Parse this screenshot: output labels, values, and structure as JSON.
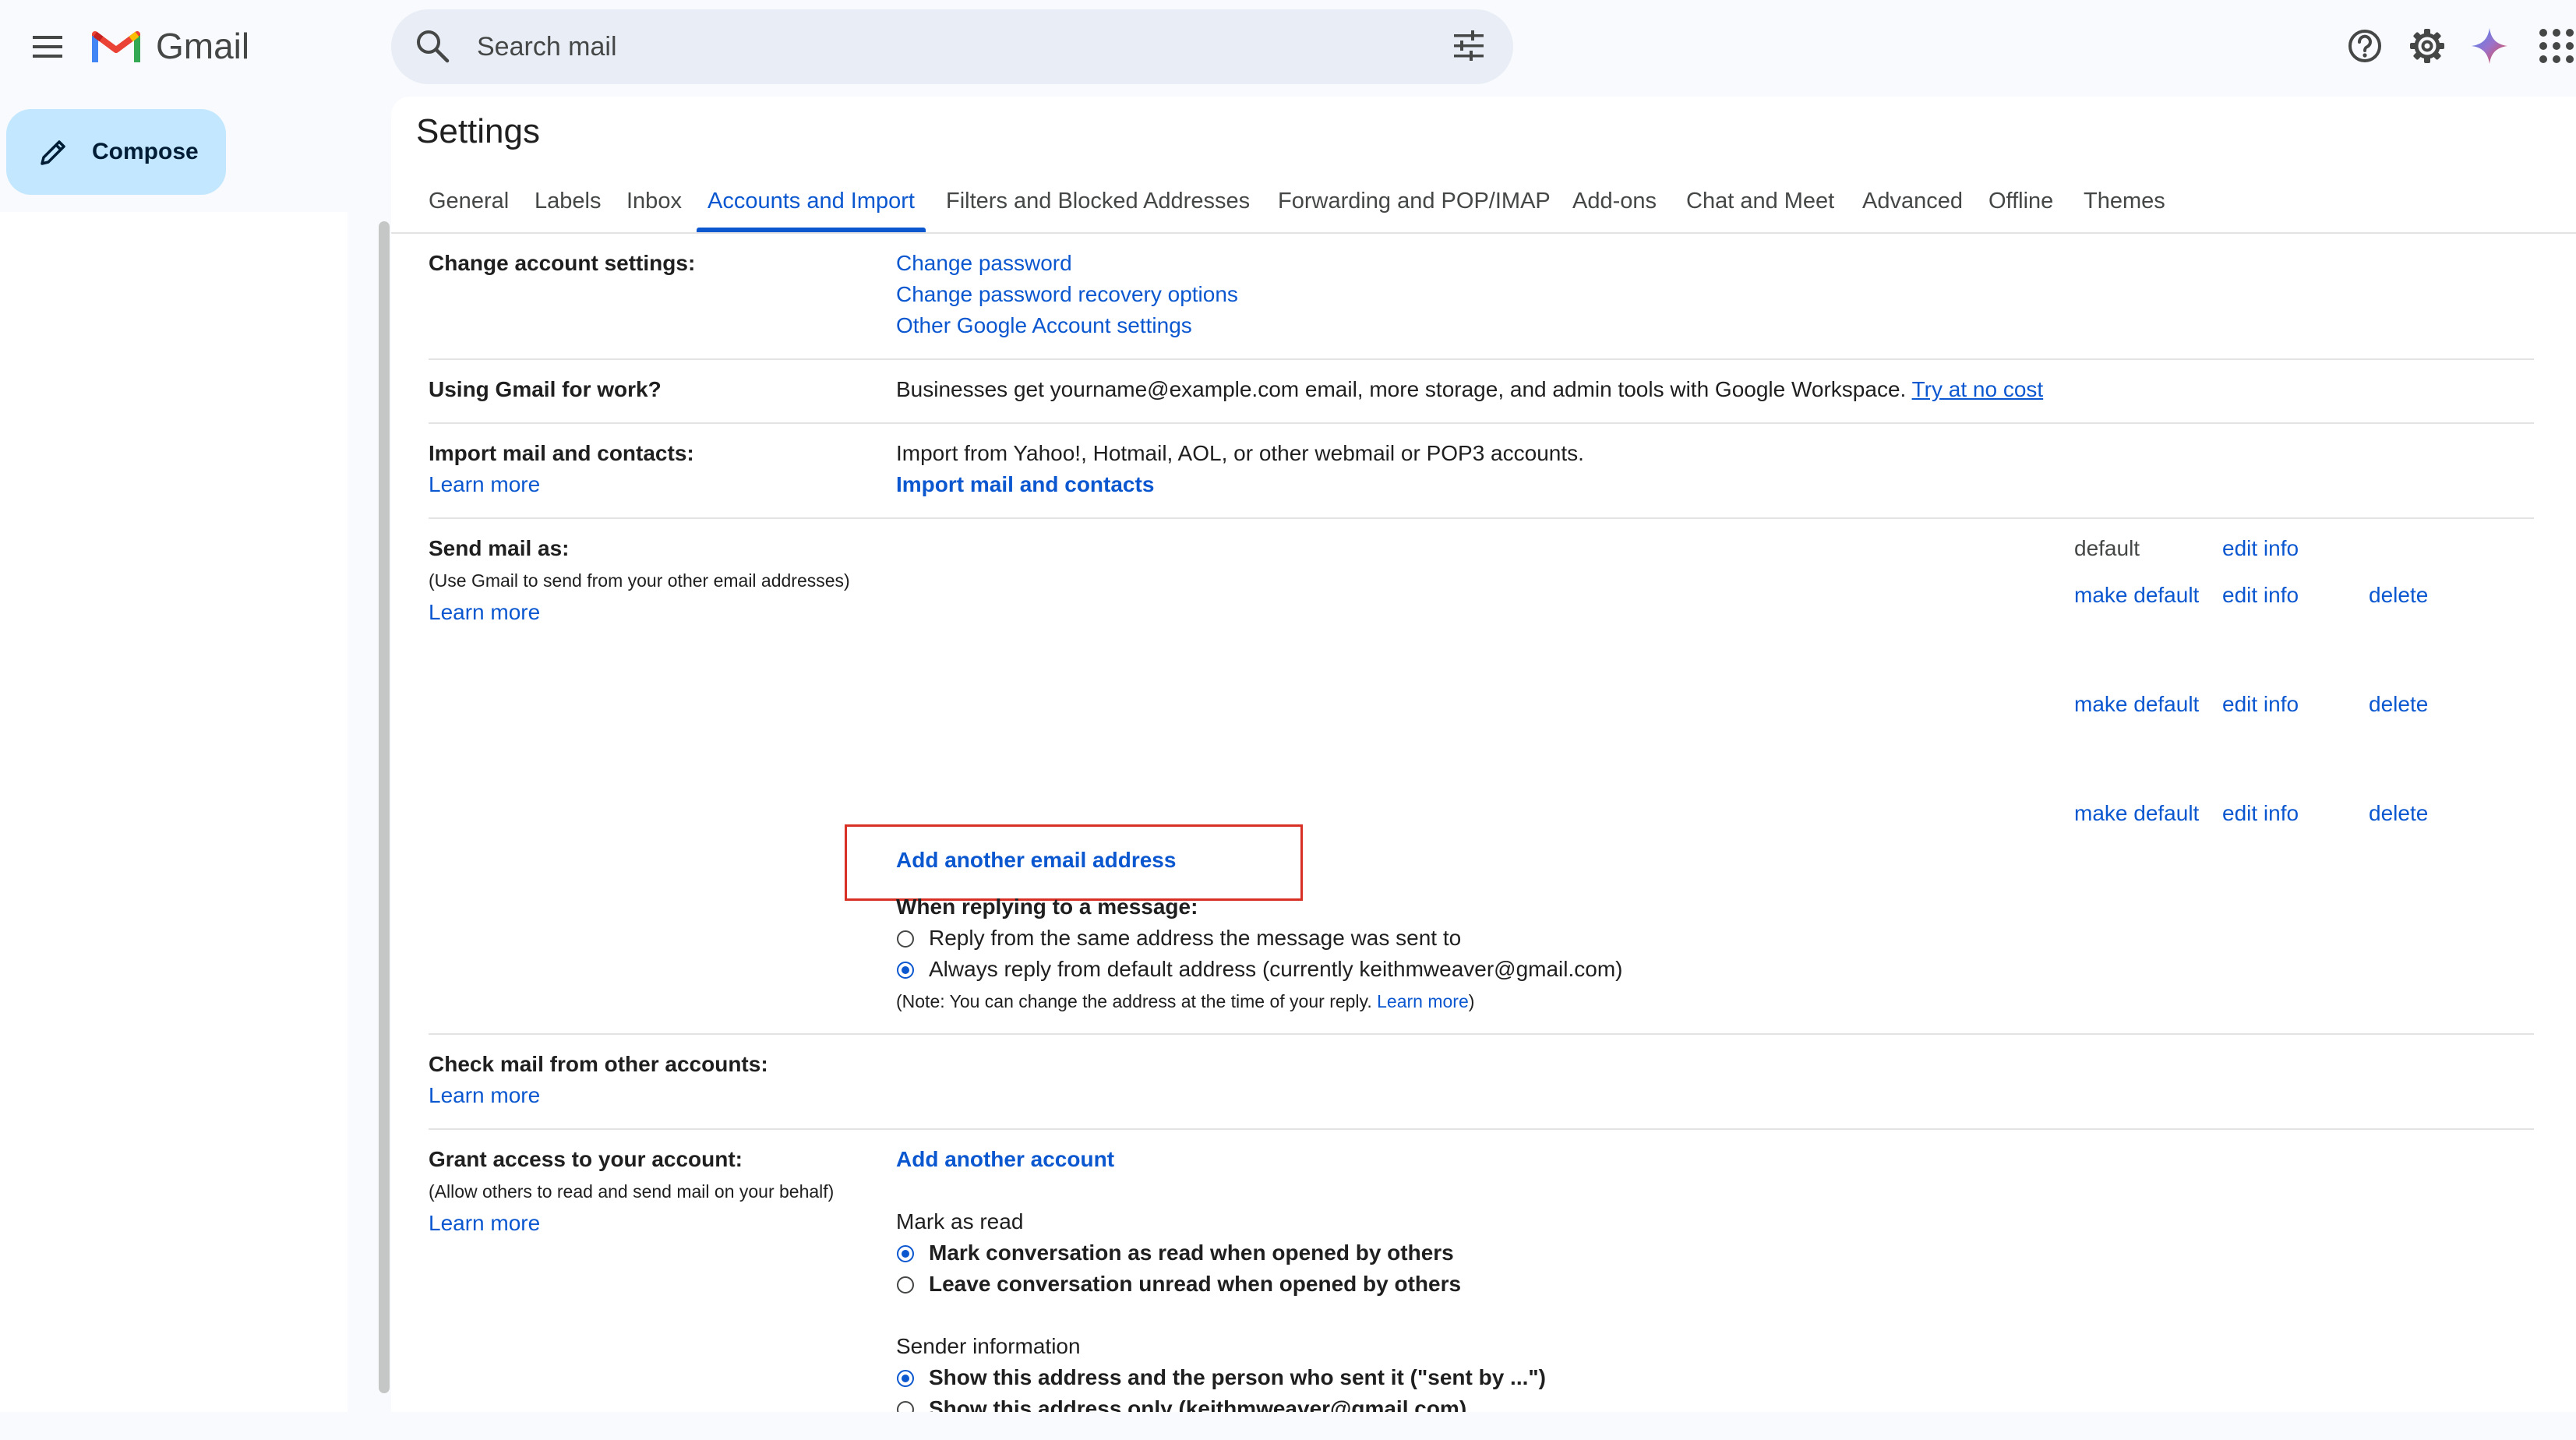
{
  "header": {
    "brand": "Gmail",
    "search_placeholder": "Search mail",
    "icons": [
      "menu-icon",
      "gmail-logo",
      "search-icon",
      "tune-icon",
      "help-icon",
      "gear-icon",
      "gemini-icon",
      "apps-grid-icon"
    ]
  },
  "compose": {
    "label": "Compose"
  },
  "settings": {
    "title": "Settings",
    "tabs": [
      {
        "label": "General"
      },
      {
        "label": "Labels"
      },
      {
        "label": "Inbox"
      },
      {
        "label": "Accounts and Import",
        "active": true
      },
      {
        "label": "Filters and Blocked Addresses"
      },
      {
        "label": "Forwarding and POP/IMAP"
      },
      {
        "label": "Add-ons"
      },
      {
        "label": "Chat and Meet"
      },
      {
        "label": "Advanced"
      },
      {
        "label": "Offline"
      },
      {
        "label": "Themes"
      }
    ]
  },
  "sections": {
    "change_account": {
      "label": "Change account settings:",
      "links": [
        "Change password",
        "Change password recovery options",
        "Other Google Account settings"
      ]
    },
    "work": {
      "label": "Using Gmail for work?",
      "text": "Businesses get yourname@example.com email, more storage, and admin tools with Google Workspace.",
      "link": "Try at no cost"
    },
    "import": {
      "label": "Import mail and contacts:",
      "learn_more": "Learn more",
      "text": "Import from Yahoo!, Hotmail, AOL, or other webmail or POP3 accounts.",
      "action": "Import mail and contacts"
    },
    "send_as": {
      "label": "Send mail as:",
      "sub": "(Use Gmail to send from your other email addresses)",
      "learn_more": "Learn more",
      "default_text": "default",
      "make_default": "make default",
      "edit_info": "edit info",
      "delete": "delete",
      "add_address": "Add another email address",
      "reply_heading": "When replying to a message:",
      "reply_options": [
        {
          "label": "Reply from the same address the message was sent to",
          "checked": false
        },
        {
          "label": "Always reply from default address (currently keithmweaver@gmail.com)",
          "checked": true
        }
      ],
      "note": "(Note: You can change the address at the time of your reply.",
      "note_link": "Learn more",
      "note_close": ")"
    },
    "check_mail": {
      "label": "Check mail from other accounts:",
      "learn_more": "Learn more"
    },
    "grant": {
      "label": "Grant access to your account:",
      "sub": "(Allow others to read and send mail on your behalf)",
      "learn_more": "Learn more",
      "add_account": "Add another account",
      "mark_heading": "Mark as read",
      "mark_options": [
        {
          "label": "Mark conversation as read when opened by others",
          "checked": true
        },
        {
          "label": "Leave conversation unread when opened by others",
          "checked": false
        }
      ],
      "sender_heading": "Sender information",
      "sender_options": [
        {
          "label": "Show this address and the person who sent it (\"sent by ...\")",
          "checked": true
        },
        {
          "label": "Show this address only (keithmweaver@gmail.com)",
          "checked": false
        }
      ]
    }
  },
  "colors": {
    "link": "#0b57d0",
    "compose_bg": "#c2e7ff",
    "highlight": "#d93025"
  }
}
